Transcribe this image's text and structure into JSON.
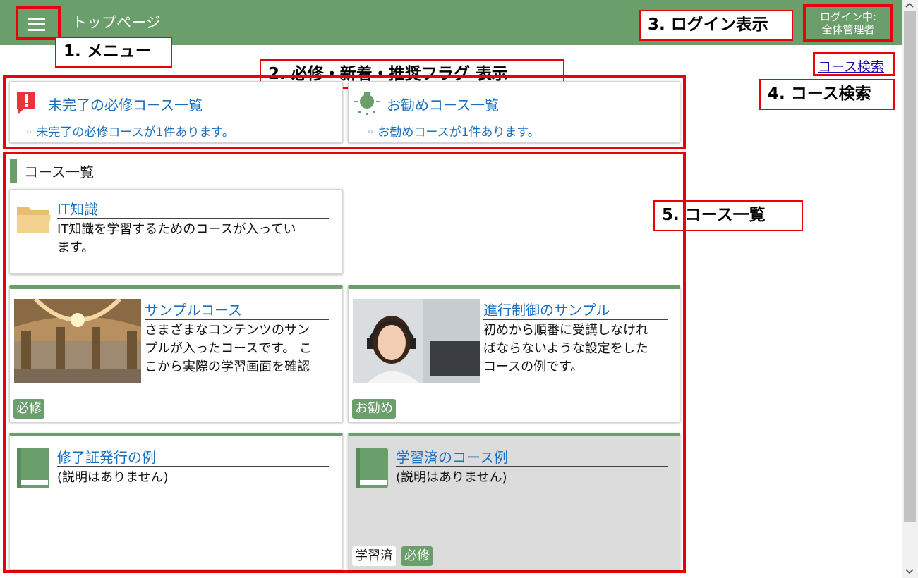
{
  "header": {
    "title": "トップページ",
    "login_line1": "ログイン中:",
    "login_line2": "全体管理者"
  },
  "callouts": {
    "menu": "1. メニュー",
    "flags": "2. 必修・新着・推奨フラグ 表示",
    "login": "3. ログイン表示",
    "search": "4. コース検索",
    "course_list": "5. コース一覧"
  },
  "search_link": "コース検索",
  "notices": {
    "required": {
      "title": "未完了の必修コース一覧",
      "text": "◦ 未完了の必修コースが1件あります。"
    },
    "recommended": {
      "title": "お勧めコース一覧",
      "text": "◦ お勧めコースが1件あります。"
    }
  },
  "course_list": {
    "heading": "コース一覧",
    "folder": {
      "title": "IT知識",
      "desc_line1": "IT知識を学習するためのコースが入ってい",
      "desc_line2": "ます。"
    },
    "courses": [
      {
        "title": "サンプルコース",
        "desc_line1": "さまざまなコンテンツのサン",
        "desc_line2": "プルが入ったコースです。 こ",
        "desc_line3": "こから実際の学習画面を確認",
        "tag": "必修"
      },
      {
        "title": "進行制御のサンプル",
        "desc_line1": "初めから順番に受講しなけれ",
        "desc_line2": "ばならないような設定をした",
        "desc_line3": "コースの例です。",
        "tag": "お勧め"
      },
      {
        "title": "修了証発行の例",
        "desc_line1": "(説明はありません)"
      },
      {
        "title": "学習済のコース例",
        "desc_line1": "(説明はありません)",
        "tag1": "学習済",
        "tag2": "必修"
      }
    ]
  },
  "colors": {
    "brand_green": "#6a9e6b",
    "annotation_red": "#e8000b",
    "link_blue": "#1a6fbf",
    "folder": "#e8bd70"
  },
  "icons": [
    "menu-icon",
    "exclamation-icon",
    "lightbulb-icon",
    "folder-icon",
    "book-icon"
  ]
}
